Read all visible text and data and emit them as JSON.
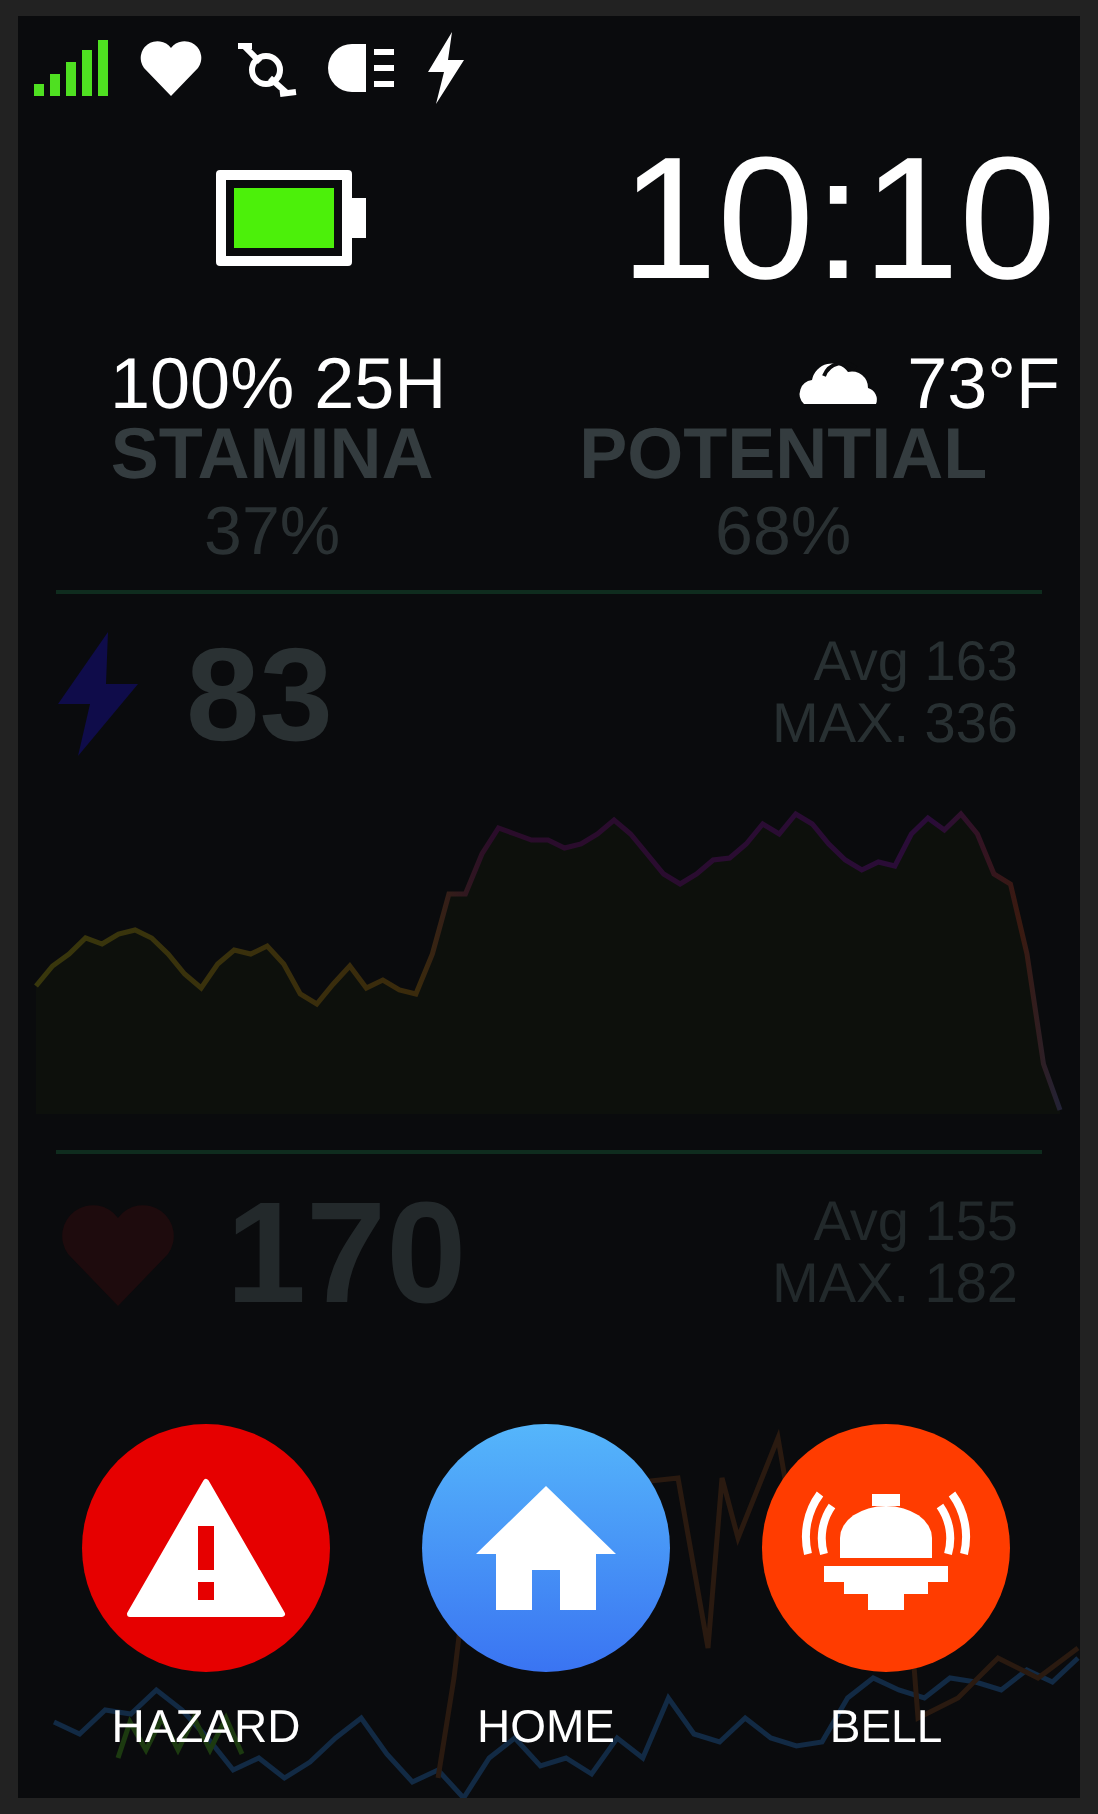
{
  "clock": {
    "time": "10:10"
  },
  "battery": {
    "reading": "100% 25H"
  },
  "weather": {
    "temperature": "73°F"
  },
  "metrics": [
    {
      "label": "STAMINA",
      "value": "37%"
    },
    {
      "label": "POTENTIAL",
      "value": "68%"
    }
  ],
  "power": {
    "value": "83",
    "avg": "Avg 163",
    "max": "MAX. 336"
  },
  "heart_rate": {
    "value": "170",
    "avg": "Avg 155",
    "max": "MAX. 182"
  },
  "quick_actions": [
    {
      "label": "HAZARD",
      "kind": "hazard"
    },
    {
      "label": "HOME",
      "kind": "home"
    },
    {
      "label": "BELL",
      "kind": "bell"
    }
  ]
}
